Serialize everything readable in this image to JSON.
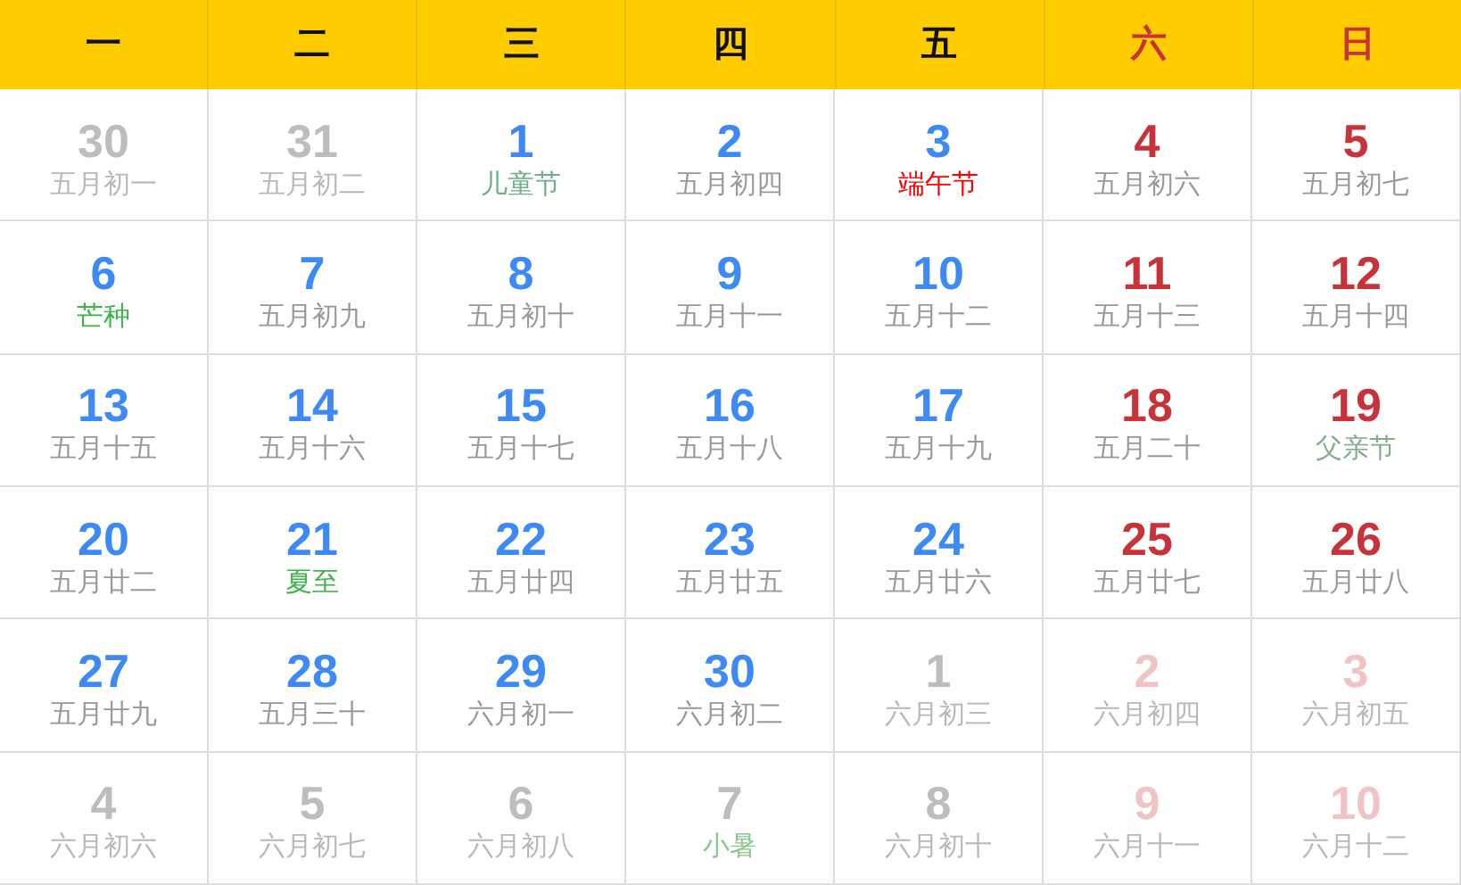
{
  "weekdays": [
    {
      "label": "一",
      "weekend": false
    },
    {
      "label": "二",
      "weekend": false
    },
    {
      "label": "三",
      "weekend": false
    },
    {
      "label": "四",
      "weekend": false
    },
    {
      "label": "五",
      "weekend": false
    },
    {
      "label": "六",
      "weekend": true
    },
    {
      "label": "日",
      "weekend": true
    }
  ],
  "weeks": [
    [
      {
        "day": "30",
        "lunar": "五月初一",
        "in_month": false,
        "weekend": false
      },
      {
        "day": "31",
        "lunar": "五月初二",
        "in_month": false,
        "weekend": false
      },
      {
        "day": "1",
        "lunar": "儿童节",
        "in_month": true,
        "weekend": false,
        "color": "#6fae8c"
      },
      {
        "day": "2",
        "lunar": "五月初四",
        "in_month": true,
        "weekend": false
      },
      {
        "day": "3",
        "lunar": "端午节",
        "in_month": true,
        "weekend": false,
        "color": "#ff0000"
      },
      {
        "day": "4",
        "lunar": "五月初六",
        "in_month": true,
        "weekend": true
      },
      {
        "day": "5",
        "lunar": "五月初七",
        "in_month": true,
        "weekend": true
      }
    ],
    [
      {
        "day": "6",
        "lunar": "芒种",
        "in_month": true,
        "weekend": false,
        "color": "#3bb54a"
      },
      {
        "day": "7",
        "lunar": "五月初九",
        "in_month": true,
        "weekend": false
      },
      {
        "day": "8",
        "lunar": "五月初十",
        "in_month": true,
        "weekend": false
      },
      {
        "day": "9",
        "lunar": "五月十一",
        "in_month": true,
        "weekend": false
      },
      {
        "day": "10",
        "lunar": "五月十二",
        "in_month": true,
        "weekend": false
      },
      {
        "day": "11",
        "lunar": "五月十三",
        "in_month": true,
        "weekend": true
      },
      {
        "day": "12",
        "lunar": "五月十四",
        "in_month": true,
        "weekend": true
      }
    ],
    [
      {
        "day": "13",
        "lunar": "五月十五",
        "in_month": true,
        "weekend": false
      },
      {
        "day": "14",
        "lunar": "五月十六",
        "in_month": true,
        "weekend": false
      },
      {
        "day": "15",
        "lunar": "五月十七",
        "in_month": true,
        "weekend": false
      },
      {
        "day": "16",
        "lunar": "五月十八",
        "in_month": true,
        "weekend": false
      },
      {
        "day": "17",
        "lunar": "五月十九",
        "in_month": true,
        "weekend": false
      },
      {
        "day": "18",
        "lunar": "五月二十",
        "in_month": true,
        "weekend": true
      },
      {
        "day": "19",
        "lunar": "父亲节",
        "in_month": true,
        "weekend": true,
        "color": "#7fae8c"
      }
    ],
    [
      {
        "day": "20",
        "lunar": "五月廿二",
        "in_month": true,
        "weekend": false
      },
      {
        "day": "21",
        "lunar": "夏至",
        "in_month": true,
        "weekend": false,
        "color": "#3bb54a"
      },
      {
        "day": "22",
        "lunar": "五月廿四",
        "in_month": true,
        "weekend": false
      },
      {
        "day": "23",
        "lunar": "五月廿五",
        "in_month": true,
        "weekend": false
      },
      {
        "day": "24",
        "lunar": "五月廿六",
        "in_month": true,
        "weekend": false
      },
      {
        "day": "25",
        "lunar": "五月廿七",
        "in_month": true,
        "weekend": true
      },
      {
        "day": "26",
        "lunar": "五月廿八",
        "in_month": true,
        "weekend": true
      }
    ],
    [
      {
        "day": "27",
        "lunar": "五月廿九",
        "in_month": true,
        "weekend": false
      },
      {
        "day": "28",
        "lunar": "五月三十",
        "in_month": true,
        "weekend": false
      },
      {
        "day": "29",
        "lunar": "六月初一",
        "in_month": true,
        "weekend": false
      },
      {
        "day": "30",
        "lunar": "六月初二",
        "in_month": true,
        "weekend": false
      },
      {
        "day": "1",
        "lunar": "六月初三",
        "in_month": false,
        "weekend": false
      },
      {
        "day": "2",
        "lunar": "六月初四",
        "in_month": false,
        "weekend": true
      },
      {
        "day": "3",
        "lunar": "六月初五",
        "in_month": false,
        "weekend": true
      }
    ],
    [
      {
        "day": "4",
        "lunar": "六月初六",
        "in_month": false,
        "weekend": false
      },
      {
        "day": "5",
        "lunar": "六月初七",
        "in_month": false,
        "weekend": false
      },
      {
        "day": "6",
        "lunar": "六月初八",
        "in_month": false,
        "weekend": false
      },
      {
        "day": "7",
        "lunar": "小暑",
        "in_month": false,
        "weekend": false,
        "color": "#86c98e"
      },
      {
        "day": "8",
        "lunar": "六月初十",
        "in_month": false,
        "weekend": false
      },
      {
        "day": "9",
        "lunar": "六月十一",
        "in_month": false,
        "weekend": true
      },
      {
        "day": "10",
        "lunar": "六月十二",
        "in_month": false,
        "weekend": true
      }
    ]
  ]
}
